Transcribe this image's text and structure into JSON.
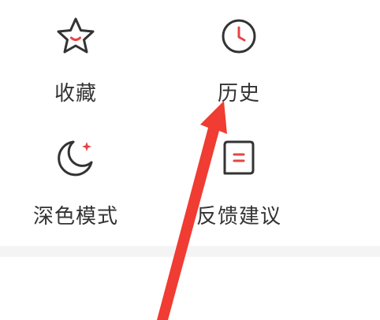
{
  "menu": {
    "items": [
      {
        "label": "收藏",
        "icon": "star-icon"
      },
      {
        "label": "历史",
        "icon": "clock-icon"
      },
      {
        "label": "深色模式",
        "icon": "moon-icon"
      },
      {
        "label": "反馈建议",
        "icon": "feedback-icon"
      }
    ]
  },
  "colors": {
    "icon_stroke": "#333333",
    "icon_accent": "#e64545",
    "label_text": "#333333",
    "separator": "#f4f4f4",
    "annotation_arrow": "#f03c32"
  }
}
